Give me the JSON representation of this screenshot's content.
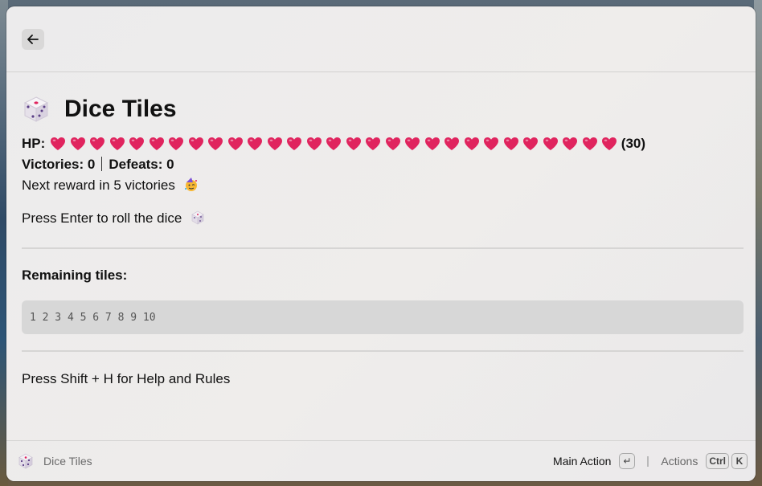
{
  "header": {
    "back_label": "Back"
  },
  "game": {
    "title": "Dice Tiles",
    "hp_label": "HP:",
    "hp_count": "(30)",
    "hearts": 29,
    "victories_text": "Victories: 0",
    "defeats_text": "Defeats: 0",
    "reward_text": "Next reward in 5 victories",
    "roll_text": "Press Enter to roll the dice",
    "remaining_label": "Remaining tiles:",
    "tiles": "1 2 3 4 5 6 7 8 9 10",
    "help_text": "Press Shift + H for Help and Rules"
  },
  "footer": {
    "title": "Dice Tiles",
    "main_action_label": "Main Action",
    "enter_key": "↵",
    "actions_label": "Actions",
    "ctrl_key": "Ctrl",
    "k_key": "K"
  },
  "icons": {
    "title": "dice-icon",
    "heart": "heart-icon",
    "reward": "party-face-icon",
    "back": "arrow-left-icon"
  },
  "colors": {
    "heart": "#e0245e",
    "accent": "#111111"
  }
}
